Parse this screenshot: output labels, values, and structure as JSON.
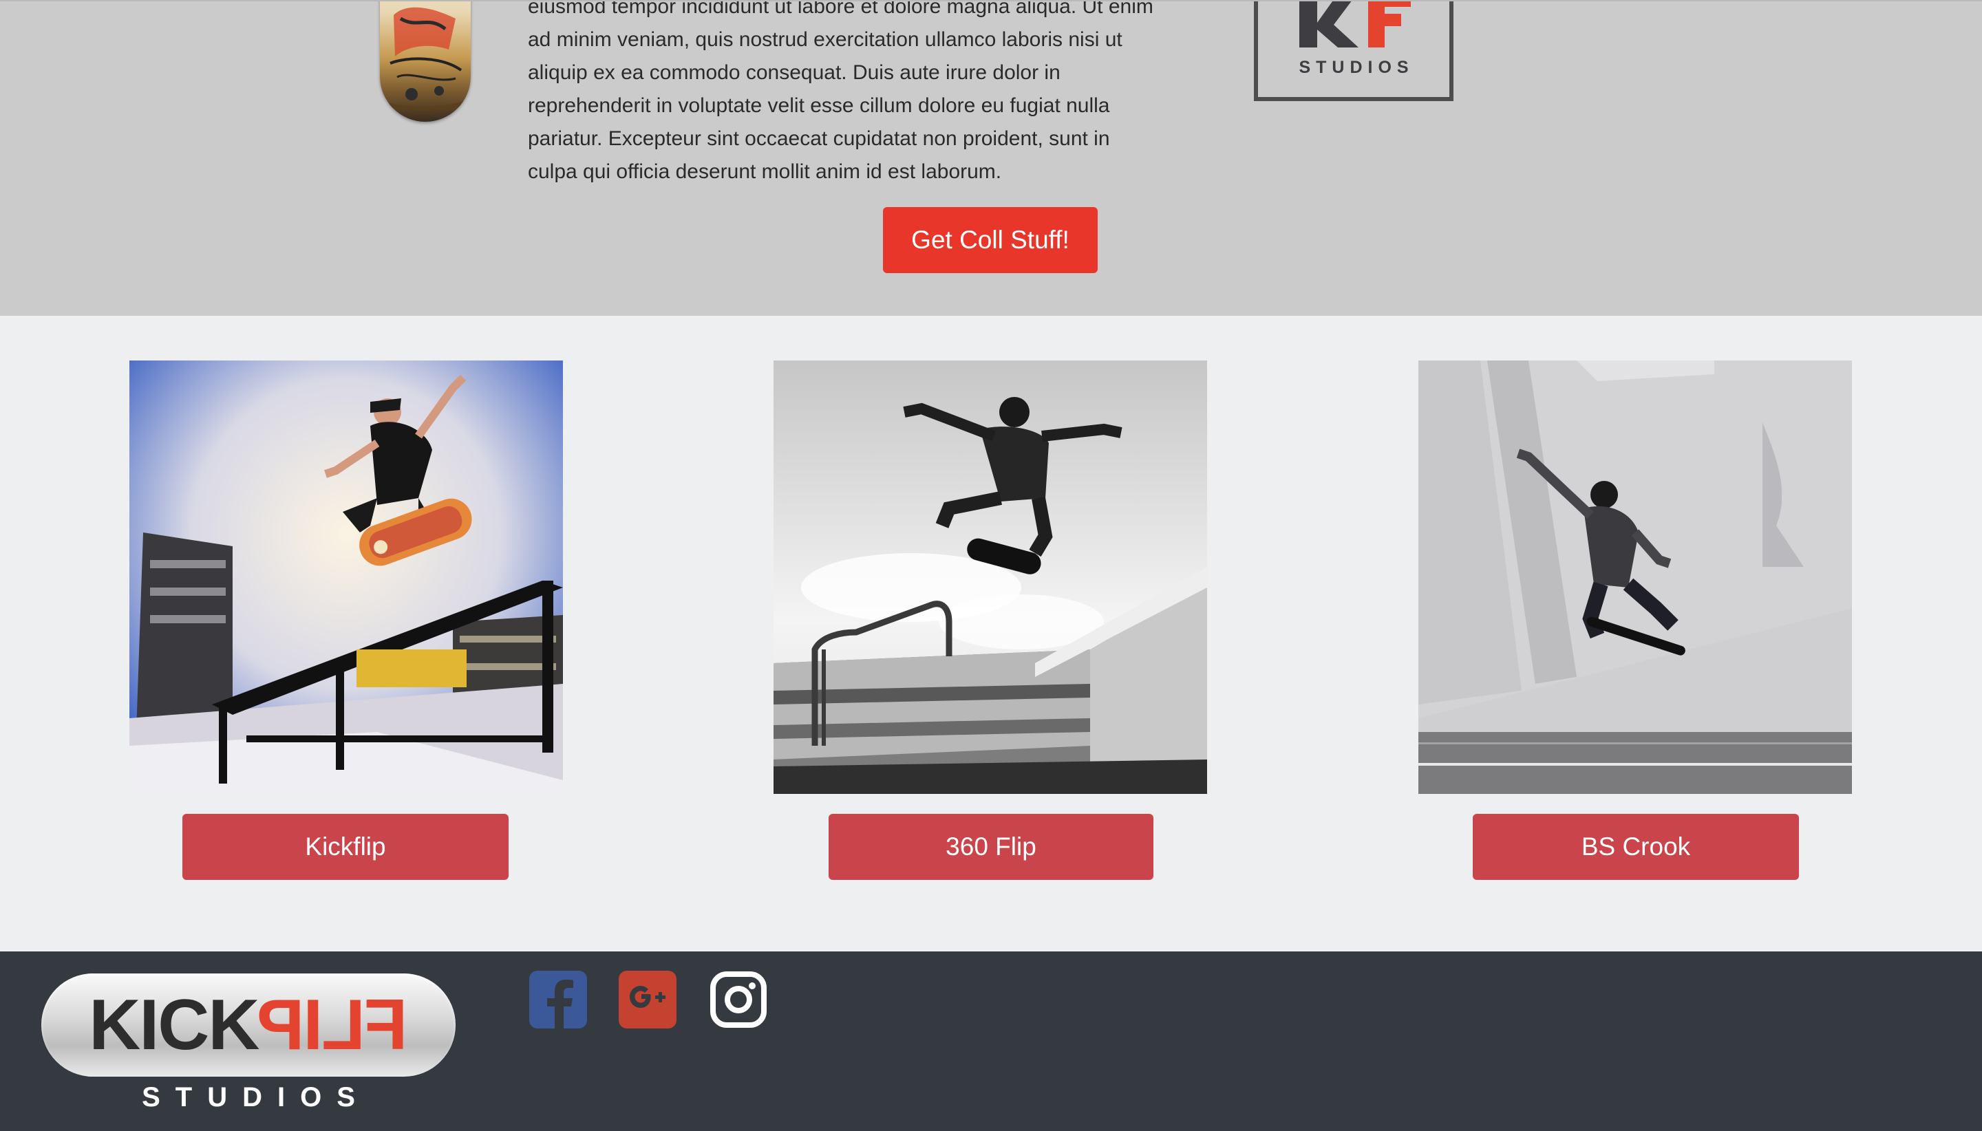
{
  "intro": {
    "lines": [
      "eiusmod tempor incididunt ut labore et dolore magna aliqua. Ut enim",
      "ad minim veniam, quis nostrud exercitation ullamco laboris nisi ut",
      "aliquip ex ea commodo consequat. Duis aute irure dolor in",
      "reprehenderit in voluptate velit esse cillum dolore eu fugiat nulla",
      "pariatur. Excepteur sint occaecat cupidatat non proident, sunt in",
      "culpa qui officia deserunt mollit anim id est laborum."
    ],
    "cta_label": "Get Coll Stuff!"
  },
  "badge": {
    "studios_label": "STUDIOS"
  },
  "tricks": [
    {
      "label": "Kickflip"
    },
    {
      "label": "360 Flip"
    },
    {
      "label": "BS Crook"
    }
  ],
  "footer": {
    "logo_kick": "KICK",
    "logo_flip": "FLIP",
    "logo_studios": "STUDIOS",
    "social": [
      {
        "icon": "facebook-icon",
        "color": "#3b5998"
      },
      {
        "icon": "google-plus-icon",
        "color": "#c4422f"
      },
      {
        "icon": "instagram-icon",
        "color": "#ffffff"
      }
    ]
  },
  "colors": {
    "cta": "#e8362b",
    "trick_button": "#c9444b",
    "footer_bg": "#343a40",
    "top_bg": "#cbcbcb"
  }
}
